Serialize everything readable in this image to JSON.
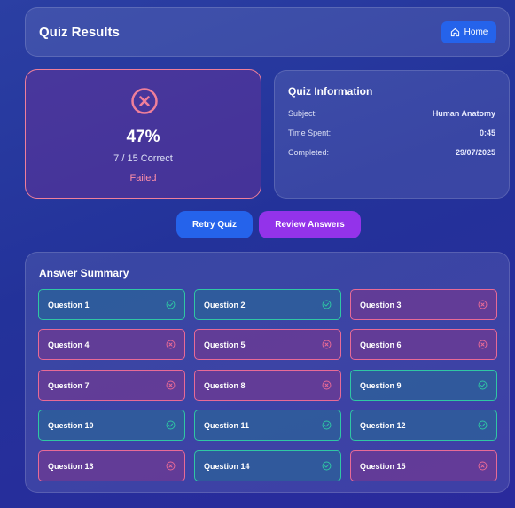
{
  "header": {
    "title": "Quiz Results",
    "home_label": "Home"
  },
  "score": {
    "percent": "47%",
    "count": "7 / 15 Correct",
    "status": "Failed"
  },
  "info": {
    "title": "Quiz Information",
    "rows": [
      {
        "label": "Subject:",
        "value": "Human Anatomy"
      },
      {
        "label": "Time Spent:",
        "value": "0:45"
      },
      {
        "label": "Completed:",
        "value": "29/07/2025"
      }
    ]
  },
  "actions": {
    "retry_label": "Retry Quiz",
    "review_label": "Review Answers"
  },
  "summary": {
    "title": "Answer Summary",
    "questions": [
      {
        "label": "Question 1",
        "result": "correct"
      },
      {
        "label": "Question 2",
        "result": "correct"
      },
      {
        "label": "Question 3",
        "result": "wrong"
      },
      {
        "label": "Question 4",
        "result": "wrong"
      },
      {
        "label": "Question 5",
        "result": "wrong"
      },
      {
        "label": "Question 6",
        "result": "wrong"
      },
      {
        "label": "Question 7",
        "result": "wrong"
      },
      {
        "label": "Question 8",
        "result": "wrong"
      },
      {
        "label": "Question 9",
        "result": "correct"
      },
      {
        "label": "Question 10",
        "result": "correct"
      },
      {
        "label": "Question 11",
        "result": "correct"
      },
      {
        "label": "Question 12",
        "result": "correct"
      },
      {
        "label": "Question 13",
        "result": "wrong"
      },
      {
        "label": "Question 14",
        "result": "correct"
      },
      {
        "label": "Question 15",
        "result": "wrong"
      }
    ]
  },
  "colors": {
    "correct": "#2fc7a4",
    "wrong": "#e96a96",
    "primary": "#2563eb",
    "secondary": "#9333ea"
  },
  "icons": {
    "home": "home-icon",
    "correct": "check-circle-icon",
    "wrong": "x-circle-icon",
    "fail": "x-circle-icon"
  }
}
